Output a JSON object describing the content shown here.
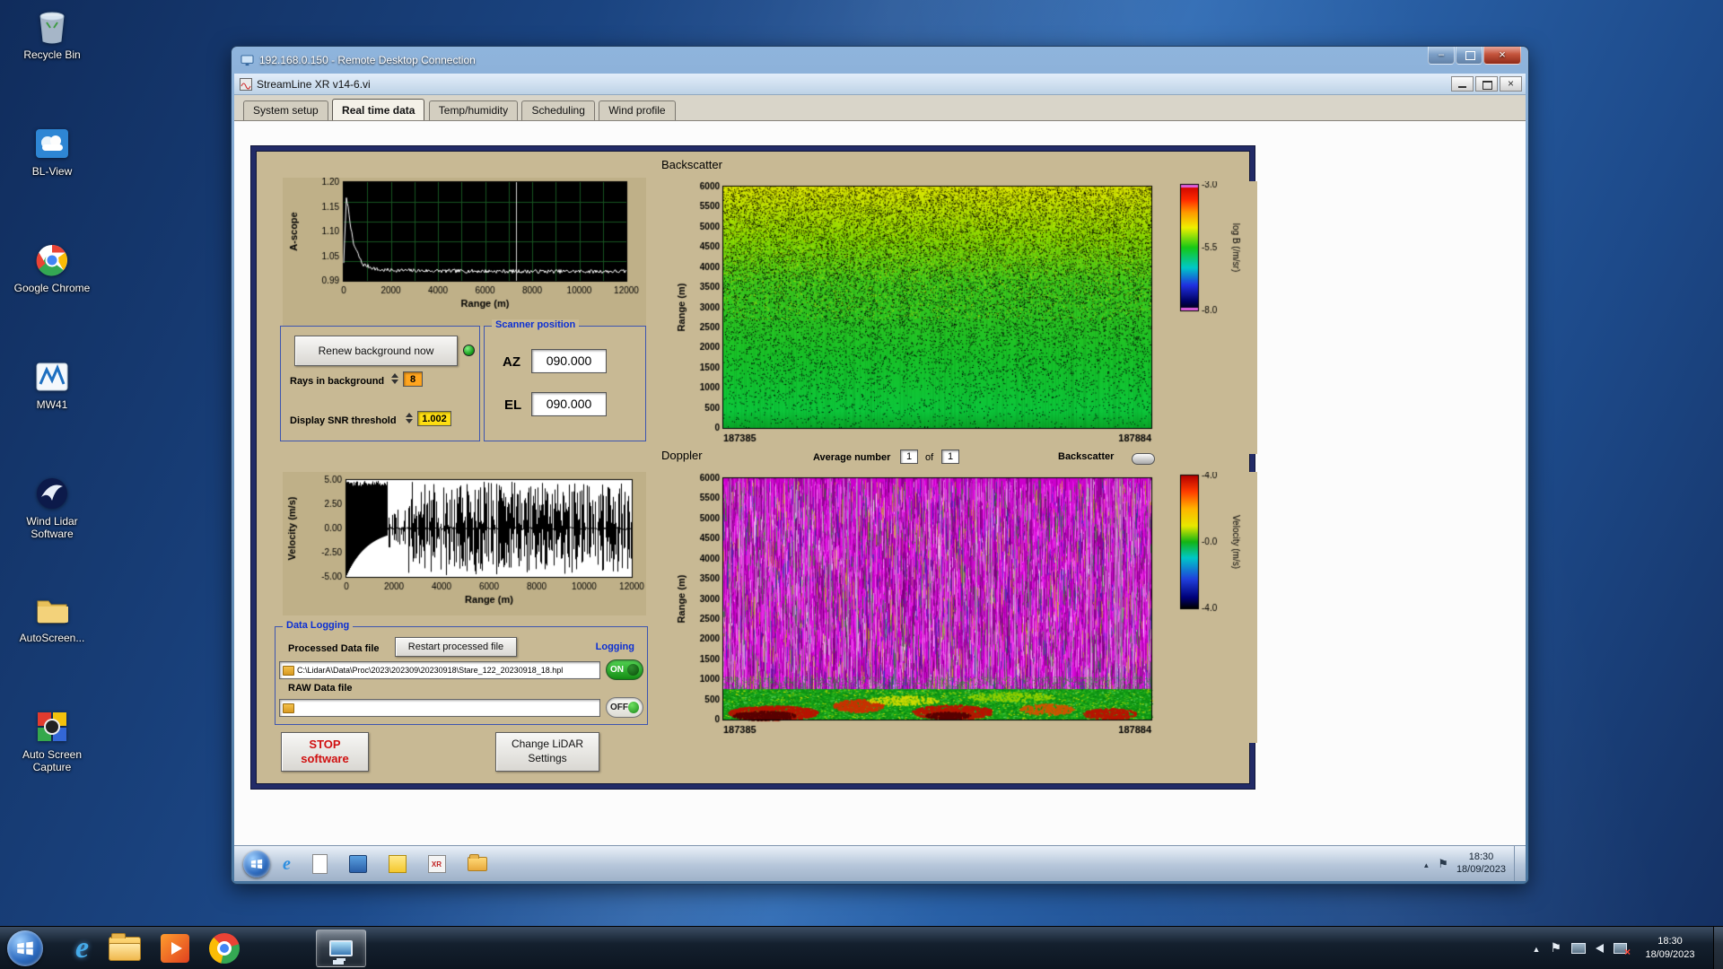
{
  "desktop_icons": [
    {
      "id": "recycle-bin",
      "label": "Recycle Bin"
    },
    {
      "id": "bl-view",
      "label": "BL-View"
    },
    {
      "id": "google-chrome",
      "label": "Google Chrome"
    },
    {
      "id": "mw41",
      "label": "MW41"
    },
    {
      "id": "wind-lidar-software",
      "label": "Wind Lidar Software"
    },
    {
      "id": "autoscreen",
      "label": "AutoScreen..."
    },
    {
      "id": "auto-screen-capture",
      "label": "Auto Screen Capture"
    }
  ],
  "rdp": {
    "title": "192.168.0.150 - Remote Desktop Connection"
  },
  "app": {
    "title": "StreamLine XR v14-6.vi",
    "tabs": [
      {
        "label": "System setup",
        "active": false
      },
      {
        "label": "Real time data",
        "active": true
      },
      {
        "label": "Temp/humidity",
        "active": false
      },
      {
        "label": "Scheduling",
        "active": false
      },
      {
        "label": "Wind profile",
        "active": false
      }
    ]
  },
  "controls": {
    "renew_button": "Renew background now",
    "rays_label": "Rays in background",
    "rays_value": "8",
    "snr_label": "Display SNR threshold",
    "snr_value": "1.002",
    "scanner": {
      "title": "Scanner position",
      "az_label": "AZ",
      "az_value": "090.000",
      "el_label": "EL",
      "el_value": "090.000"
    },
    "doppler_header": {
      "avg_label": "Average number",
      "avg_value": "1",
      "of_label": "of",
      "of_value": "1",
      "toggle_label": "Backscatter"
    },
    "logging": {
      "title": "Data Logging",
      "processed_label": "Processed Data file",
      "restart_button": "Restart processed file",
      "logging_label": "Logging",
      "processed_path": "C:\\LidarA\\Data\\Proc\\2023\\202309\\20230918\\Stare_122_20230918_18.hpl",
      "on_label": "ON",
      "raw_label": "RAW Data file",
      "raw_path": "",
      "off_label": "OFF"
    },
    "stop_button": "STOP software",
    "change_button": "Change LiDAR Settings"
  },
  "chart_data": [
    {
      "id": "ascope",
      "type": "line",
      "title": "",
      "ylabel": "A-scope",
      "xlabel": "Range (m)",
      "ylim": [
        0.99,
        1.2
      ],
      "xlim": [
        0,
        12000
      ],
      "yticks": [
        "1.20",
        "1.15",
        "1.10",
        "1.05",
        "0.99"
      ],
      "xticks": [
        "0",
        "2000",
        "4000",
        "6000",
        "8000",
        "10000",
        "12000"
      ],
      "series": [
        {
          "name": "a-scope",
          "points": [
            [
              0,
              1.03
            ],
            [
              120,
              1.17
            ],
            [
              400,
              1.07
            ],
            [
              800,
              1.025
            ],
            [
              1500,
              1.013
            ],
            [
              4000,
              1.011
            ],
            [
              8000,
              1.01
            ],
            [
              12000,
              1.01
            ]
          ]
        }
      ],
      "cursor_x": 7300
    },
    {
      "id": "backscatter",
      "type": "heatmap",
      "title": "Backscatter",
      "ylabel": "Range (m)",
      "ylim": [
        0,
        6000
      ],
      "yticks": [
        "6000",
        "5500",
        "5000",
        "4500",
        "4000",
        "3500",
        "3000",
        "2500",
        "2000",
        "1500",
        "1000",
        "500",
        "0"
      ],
      "xticks": [
        "187385",
        "187884"
      ],
      "colorbar": {
        "label": "log B (/m/sr)",
        "ticks": [
          "-3.0",
          "-5.5",
          "-8.0"
        ]
      },
      "pattern": "solid yellow band above 5500 m, speckled yellow-green 3000-5500 m, green below 3000 m, bright green below 1000 m, dense black noise speckle strongest at top"
    },
    {
      "id": "velocity",
      "type": "line",
      "title": "",
      "ylabel": "Velocity (m/s)",
      "xlabel": "Range (m)",
      "ylim": [
        -5,
        5
      ],
      "xlim": [
        0,
        12000
      ],
      "yticks": [
        "5.00",
        "2.50",
        "0.00",
        "-2.50",
        "-5.00"
      ],
      "xticks": [
        "0",
        "2000",
        "4000",
        "6000",
        "8000",
        "10000",
        "12000"
      ],
      "pattern": "dense random vertical noise spikes spanning full scale; dense black block 0-1700 m with curved lower envelope rising from -4 m/s to 0 m/s near 2000 m"
    },
    {
      "id": "doppler",
      "type": "heatmap",
      "title": "Doppler",
      "ylabel": "Range (m)",
      "ylim": [
        0,
        6000
      ],
      "yticks": [
        "6000",
        "5500",
        "5000",
        "4500",
        "4000",
        "3500",
        "3000",
        "2500",
        "2000",
        "1500",
        "1000",
        "500",
        "0"
      ],
      "xticks": [
        "187385",
        "187884"
      ],
      "colorbar": {
        "label": "Velocity (m/s)",
        "ticks": [
          "-4.0",
          "-0.0",
          "-4.0"
        ]
      },
      "pattern": "magenta noise streaks above 800 m with scattered green/blue/white columns; coherent green band below 800 m with dark red patches near the ground"
    }
  ],
  "remote_taskbar": {
    "time": "18:30",
    "date": "18/09/2023"
  },
  "host_taskbar": {
    "time": "18:30",
    "date": "18/09/2023"
  }
}
